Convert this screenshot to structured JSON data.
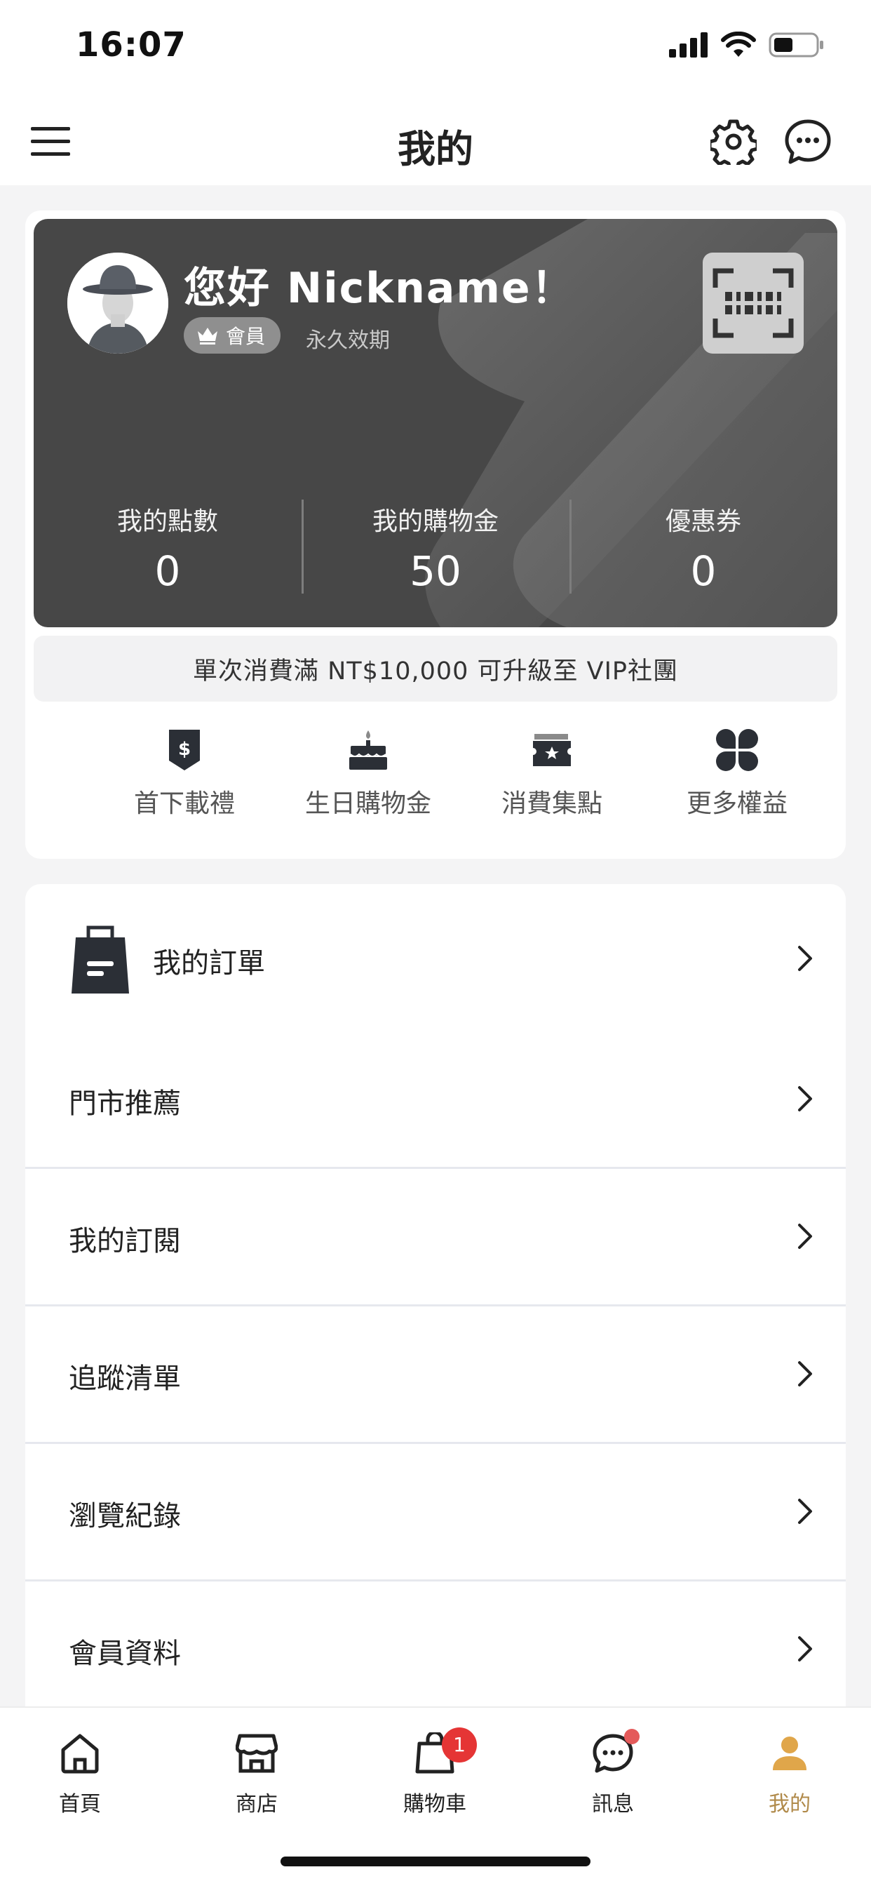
{
  "status_bar": {
    "time": "16:07"
  },
  "header": {
    "title": "我的"
  },
  "member": {
    "greeting": "您好 Nickname！",
    "badge_label": "會員",
    "validity": "永久效期",
    "stats": [
      {
        "label": "我的點數",
        "value": "0"
      },
      {
        "label": "我的購物金",
        "value": "50"
      },
      {
        "label": "優惠券",
        "value": "0"
      }
    ],
    "upgrade_text": "單次消費滿 NT$10,000 可升級至 VIP社團"
  },
  "benefits": [
    {
      "label": "首下載禮",
      "icon": "dollar-shield-icon"
    },
    {
      "label": "生日購物金",
      "icon": "cake-icon"
    },
    {
      "label": "消費集點",
      "icon": "ticket-star-icon"
    },
    {
      "label": "更多權益",
      "icon": "clover-icon"
    }
  ],
  "menu": {
    "orders_label": "我的訂單",
    "items": [
      {
        "label": "門市推薦"
      },
      {
        "label": "我的訂閱"
      },
      {
        "label": "追蹤清單"
      },
      {
        "label": "瀏覽紀錄"
      },
      {
        "label": "會員資料"
      }
    ]
  },
  "tabs": [
    {
      "label": "首頁",
      "icon": "home-icon"
    },
    {
      "label": "商店",
      "icon": "store-icon"
    },
    {
      "label": "購物車",
      "icon": "bag-icon",
      "badge": "1"
    },
    {
      "label": "訊息",
      "icon": "message-icon"
    },
    {
      "label": "我的",
      "icon": "person-icon",
      "active": true
    }
  ],
  "colors": {
    "accent": "#b08a4a",
    "card": "#474747",
    "badge": "#e53535"
  }
}
